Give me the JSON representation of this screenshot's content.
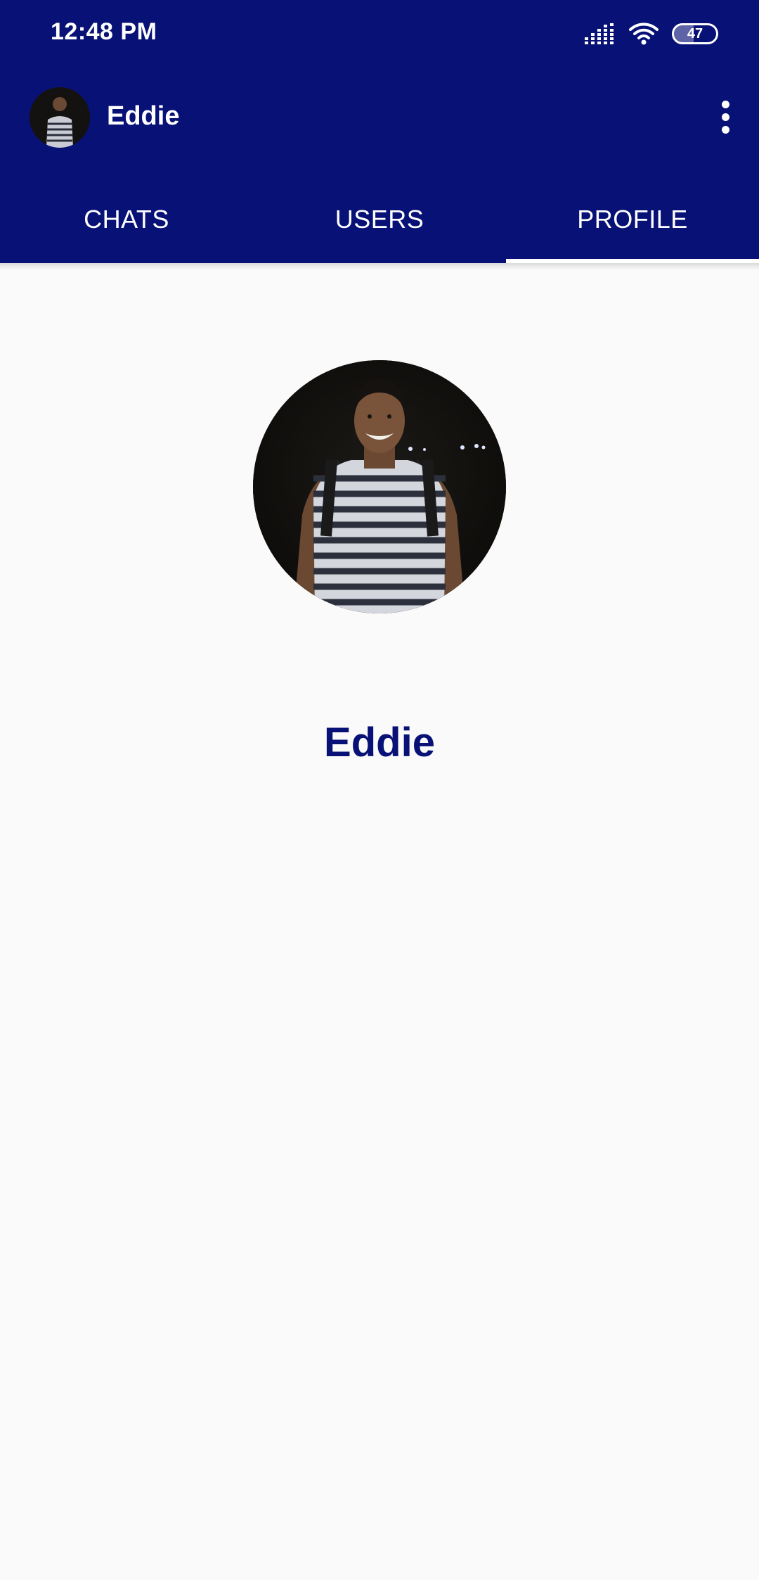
{
  "status_bar": {
    "time": "12:48 PM",
    "battery_level": "47",
    "icons": [
      "signal-icon",
      "wifi-icon",
      "battery-icon"
    ]
  },
  "toolbar": {
    "title": "Eddie",
    "avatar_icon": "user-avatar",
    "menu_icon": "more-vertical-icon"
  },
  "tabs": [
    {
      "label": "CHATS",
      "active": false
    },
    {
      "label": "USERS",
      "active": false
    },
    {
      "label": "PROFILE",
      "active": true
    }
  ],
  "profile": {
    "name": "Eddie"
  },
  "colors": {
    "primary": "#081176",
    "background": "#fafafa",
    "on_primary": "#ffffff"
  }
}
